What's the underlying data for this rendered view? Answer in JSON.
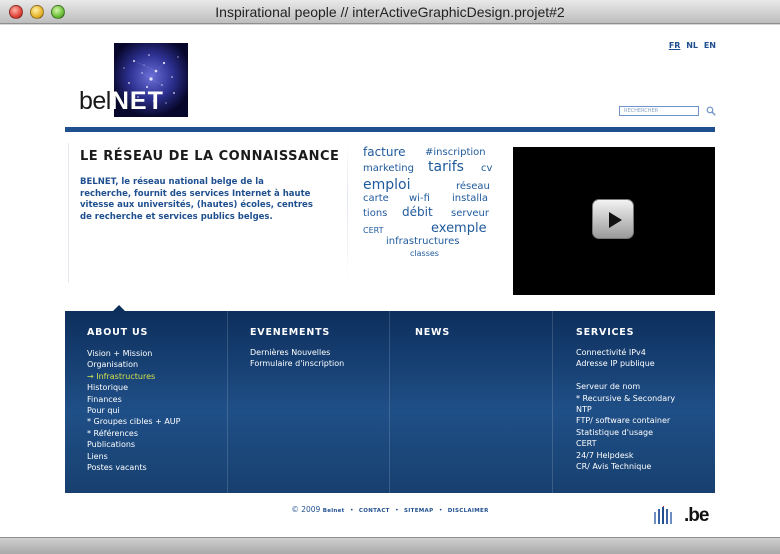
{
  "window": {
    "title": "Inspirational people // interActiveGraphicDesign.projet#2"
  },
  "logo": {
    "prefix": "bel",
    "suffix": "NET"
  },
  "languages": [
    {
      "code": "FR",
      "active": true
    },
    {
      "code": "NL",
      "active": false
    },
    {
      "code": "EN",
      "active": false
    }
  ],
  "search": {
    "placeholder": "RECHERCHER",
    "icon": "magnifier-icon"
  },
  "main": {
    "heading": "LE RÉSEAU DE LA CONNAISSANCE",
    "intro": "BELNET, le réseau national belge de la recherche, fournit des services Internet à haute vitesse aux universités, (hautes) écoles, centres de recherche et services publics belges."
  },
  "tag_cloud": [
    "facture",
    "#inscription",
    "marketing",
    "tarifs",
    "cv",
    "emploi",
    "réseau",
    "carte",
    "wi-fi",
    "installa",
    "tions",
    "débit",
    "serveur",
    "CERT",
    "exemple",
    "infrastructures",
    "classes"
  ],
  "video": {
    "icon": "play-icon"
  },
  "footer_panel": {
    "about": {
      "title": "ABOUT US",
      "items": [
        "Vision + Mission",
        "Organisation",
        "→ Infrastructures",
        "Historique",
        "Finances",
        "Pour qui",
        "* Groupes cibles + AUP",
        "* Références",
        "Publications",
        "Liens",
        "Postes vacants"
      ]
    },
    "events": {
      "title": "EVENEMENTS",
      "items": [
        "Dernières Nouvelles",
        "Formulaire d'inscription"
      ]
    },
    "news": {
      "title": "NEWS",
      "items": []
    },
    "services": {
      "title": "SERVICES",
      "items": [
        "Connectivité IPv4",
        "Adresse IP publique",
        "",
        "Serveur de nom",
        "* Recursive & Secondary",
        "NTP",
        "FTP/ software container",
        "Statistique d'usage",
        "CERT",
        "24/7 Helpdesk",
        "CR/ Avis Technique"
      ]
    }
  },
  "bottom": {
    "copyright": "© 2009",
    "brand": "Belnet",
    "links": [
      "CONTACT",
      "SITEMAP",
      "DISCLAIMER"
    ],
    "be_logo": {
      "text": ".be"
    }
  },
  "colors": {
    "brand_blue": "#1f4f8f",
    "panel_dark": "#0d2f5c",
    "highlight": "#d4e24a"
  }
}
